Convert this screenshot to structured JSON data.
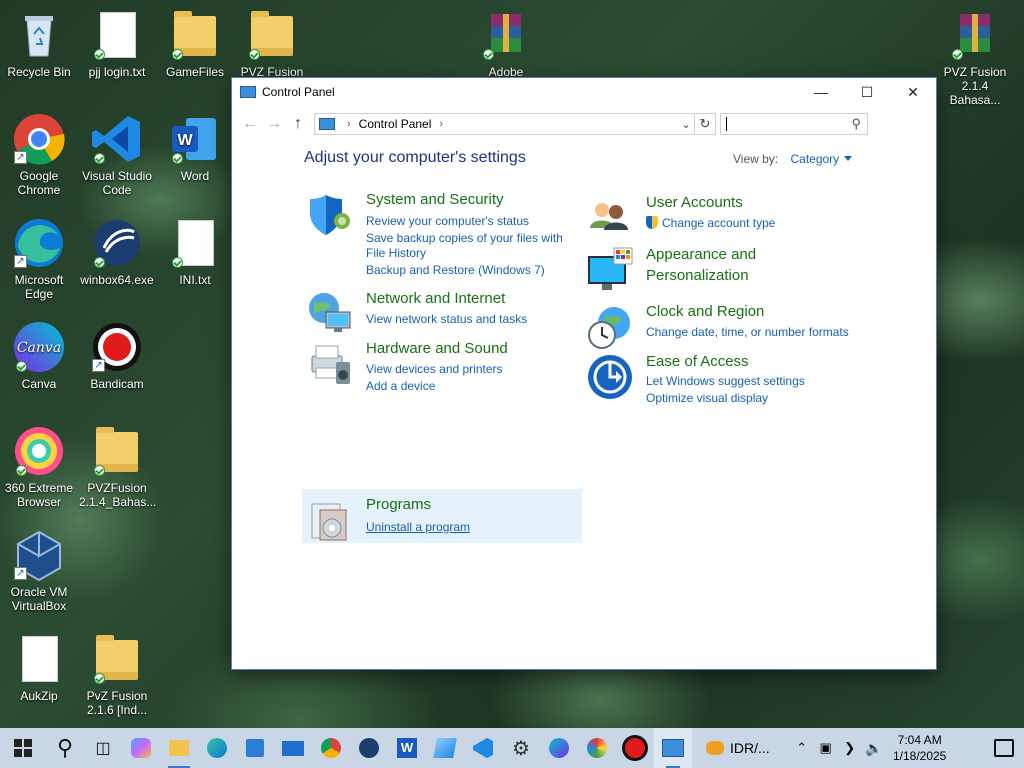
{
  "desktop_icons": [
    {
      "label": "Recycle Bin"
    },
    {
      "label": "pjj login.txt"
    },
    {
      "label": "GameFiles"
    },
    {
      "label": "PVZ Fusion"
    },
    {
      "label": "Adobe"
    },
    {
      "label": "PVZ Fusion 2.1.4 Bahasa..."
    },
    {
      "label": "Google Chrome"
    },
    {
      "label": "Visual Studio Code"
    },
    {
      "label": "Word"
    },
    {
      "label": "Microsoft Edge"
    },
    {
      "label": "winbox64.exe"
    },
    {
      "label": "INI.txt"
    },
    {
      "label": "Canva"
    },
    {
      "label": "Bandicam"
    },
    {
      "label": "360 Extreme Browser"
    },
    {
      "label": "PVZFusion 2.1.4_Bahas..."
    },
    {
      "label": "Oracle VM VirtualBox"
    },
    {
      "label": "AukZip"
    },
    {
      "label": "PvZ Fusion 2.1.6 [Ind..."
    }
  ],
  "window": {
    "title": "Control Panel",
    "breadcrumb": "Control Panel",
    "search_placeholder": ""
  },
  "content": {
    "heading": "Adjust your computer's settings",
    "view_by_label": "View by:",
    "view_by_value": "Category",
    "categories": [
      {
        "title": "System and Security",
        "links": [
          "Review your computer's status",
          "Save backup copies of your files with",
          "File History",
          "Backup and Restore (Windows 7)"
        ]
      },
      {
        "title": "Network and Internet",
        "links": [
          "View network status and tasks"
        ]
      },
      {
        "title": "Hardware and Sound",
        "links": [
          "View devices and printers",
          "Add a device"
        ]
      },
      {
        "title": "Programs",
        "links": [
          "Uninstall a program"
        ]
      },
      {
        "title": "User Accounts",
        "links": [
          "Change account type"
        ]
      },
      {
        "title": "Appearance and",
        "title2": "Personalization",
        "links": []
      },
      {
        "title": "Clock and Region",
        "links": [
          "Change date, time, or number formats"
        ]
      },
      {
        "title": "Ease of Access",
        "links": [
          "Let Windows suggest settings",
          "Optimize visual display"
        ]
      }
    ]
  },
  "taskbar": {
    "tray_text": "IDR/...",
    "time": "7:04 AM",
    "date": "1/18/2025"
  },
  "colors": {
    "heading": "#1e3287",
    "category_title": "#177017",
    "link": "#1a5fb4",
    "hover_bg": "#e5f1fb"
  }
}
